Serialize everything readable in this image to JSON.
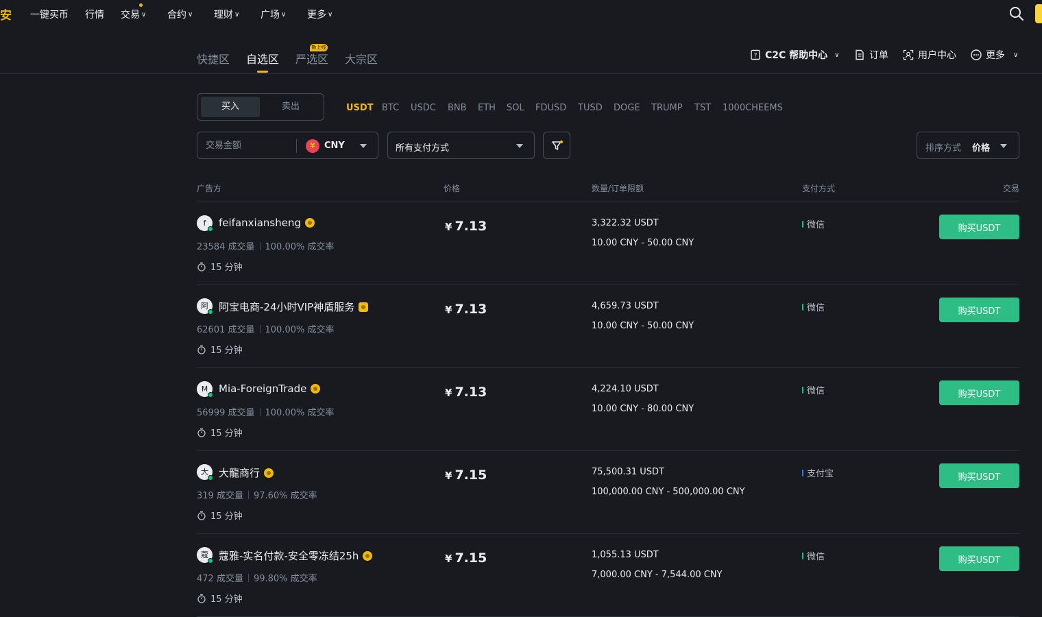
{
  "nav": {
    "logo": "安",
    "items": [
      {
        "label": "一键买币",
        "has_chevron": false
      },
      {
        "label": "行情",
        "has_chevron": false
      },
      {
        "label": "交易",
        "has_chevron": true
      },
      {
        "label": "合约",
        "has_chevron": true
      },
      {
        "label": "理财",
        "has_chevron": true
      },
      {
        "label": "广场",
        "has_chevron": true
      },
      {
        "label": "更多",
        "has_chevron": true
      }
    ]
  },
  "subnav": {
    "tabs": [
      "快捷区",
      "自选区",
      "严选区",
      "大宗区"
    ],
    "active_tab": "自选区",
    "new_badge": "新上线",
    "help": "C2C 帮助中心",
    "orders": "订单",
    "user_center": "用户中心",
    "more": "更多"
  },
  "trade": {
    "buy_label": "买入",
    "sell_label": "卖出",
    "coins": [
      "USDT",
      "BTC",
      "USDC",
      "BNB",
      "ETH",
      "SOL",
      "FDUSD",
      "TUSD",
      "DOGE",
      "TRUMP",
      "TST",
      "1000CHEEMS"
    ],
    "active_coin": "USDT",
    "amount_placeholder": "交易金额",
    "currency_symbol": "¥",
    "currency": "CNY",
    "payment_filter": "所有支付方式",
    "sort_label": "排序方式",
    "sort_value": "价格"
  },
  "table": {
    "headers": {
      "advertiser": "广告方",
      "price": "价格",
      "quantity": "数量/订单限额",
      "payment": "支付方式",
      "trade": "交易"
    },
    "rows": [
      {
        "avatar": "f",
        "name": "feifanxiansheng",
        "orders": "23584 成交量",
        "rate": "100.00% 成交率",
        "time": "15 分钟",
        "price_symbol": "¥",
        "price": "7.13",
        "qty": "3,322.32 USDT",
        "limit": "10.00 CNY - 50.00 CNY",
        "payment": "微信",
        "payment_color": "#0ecb81",
        "button": "购买USDT"
      },
      {
        "avatar": "阿",
        "name": "阿宝电商-24小时VIP神盾服务",
        "orders": "62601 成交量",
        "rate": "100.00% 成交率",
        "time": "15 分钟",
        "price_symbol": "¥",
        "price": "7.13",
        "qty": "4,659.73 USDT",
        "limit": "10.00 CNY - 50.00 CNY",
        "payment": "微信",
        "payment_color": "#0ecb81",
        "button": "购买USDT"
      },
      {
        "avatar": "M",
        "name": "Mia-ForeignTrade",
        "orders": "56999 成交量",
        "rate": "100.00% 成交率",
        "time": "15 分钟",
        "price_symbol": "¥",
        "price": "7.13",
        "qty": "4,224.10 USDT",
        "limit": "10.00 CNY - 80.00 CNY",
        "payment": "微信",
        "payment_color": "#0ecb81",
        "button": "购买USDT"
      },
      {
        "avatar": "大",
        "name": "大龍商行",
        "orders": "319 成交量",
        "rate": "97.60% 成交率",
        "time": "15 分钟",
        "price_symbol": "¥",
        "price": "7.15",
        "qty": "75,500.31 USDT",
        "limit": "100,000.00 CNY - 500,000.00 CNY",
        "payment": "支付宝",
        "payment_color": "#1e80ff",
        "button": "购买USDT"
      },
      {
        "avatar": "蔻",
        "name": "蔻雅-实名付款-安全零冻结25h",
        "orders": "472 成交量",
        "rate": "99.80% 成交率",
        "time": "15 分钟",
        "price_symbol": "¥",
        "price": "7.15",
        "qty": "1,055.13 USDT",
        "limit": "7,000.00 CNY - 7,544.00 CNY",
        "payment": "微信",
        "payment_color": "#0ecb81",
        "button": "购买USDT"
      }
    ]
  },
  "colors": {
    "background": "#181a20",
    "accent": "#f0b90b",
    "buy_green": "#2ebd85",
    "border": "#2b3139",
    "muted_text": "#848e9c"
  }
}
